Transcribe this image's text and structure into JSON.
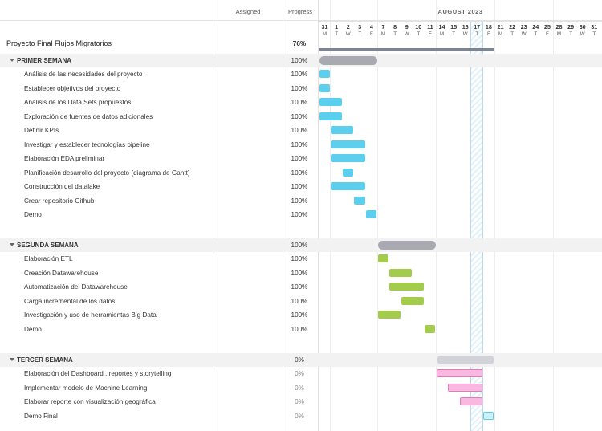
{
  "columns": {
    "assigned": "Assigned",
    "progress": "Progress"
  },
  "timeline": {
    "month": "AUGUST 2023",
    "days": [
      {
        "num": "31",
        "dow": "M"
      },
      {
        "num": "1",
        "dow": "T"
      },
      {
        "num": "2",
        "dow": "W"
      },
      {
        "num": "3",
        "dow": "T"
      },
      {
        "num": "4",
        "dow": "F"
      },
      {
        "num": "7",
        "dow": "M"
      },
      {
        "num": "8",
        "dow": "T"
      },
      {
        "num": "9",
        "dow": "W"
      },
      {
        "num": "10",
        "dow": "T"
      },
      {
        "num": "11",
        "dow": "F"
      },
      {
        "num": "14",
        "dow": "M"
      },
      {
        "num": "15",
        "dow": "T"
      },
      {
        "num": "16",
        "dow": "W"
      },
      {
        "num": "17",
        "dow": "T"
      },
      {
        "num": "18",
        "dow": "F"
      },
      {
        "num": "21",
        "dow": "M"
      },
      {
        "num": "22",
        "dow": "T"
      },
      {
        "num": "23",
        "dow": "W"
      },
      {
        "num": "24",
        "dow": "T"
      },
      {
        "num": "25",
        "dow": "F"
      },
      {
        "num": "28",
        "dow": "M"
      },
      {
        "num": "29",
        "dow": "T"
      },
      {
        "num": "30",
        "dow": "W"
      },
      {
        "num": "31",
        "dow": "T"
      }
    ],
    "today_index": 13,
    "progress_rule_end_index": 15
  },
  "project": {
    "name": "Proyecto Final Flujos Migratorios",
    "progress": "76%"
  },
  "colors": {
    "summary_bar": "#a9a9b1",
    "summary_bar_pending": "#d2d3d8",
    "week1_bar": "#5ccfee",
    "week2_bar": "#a3cc4d",
    "week3_bar": "#f8b8df",
    "week3_border": "#e07cbb",
    "final_bar": "#c8f3fb"
  },
  "groups": [
    {
      "name": "PRIMER SEMANA",
      "progress": "100%",
      "start": 0,
      "end": 5,
      "tasks": [
        {
          "name": "Análisis de las necesidades del proyecto",
          "progress": "100%",
          "start": 0,
          "end": 1
        },
        {
          "name": "Establecer objetivos del proyecto",
          "progress": "100%",
          "start": 0,
          "end": 1
        },
        {
          "name": "Análisis de los Data Sets propuestos",
          "progress": "100%",
          "start": 0,
          "end": 2
        },
        {
          "name": "Exploración de fuentes de datos adicionales",
          "progress": "100%",
          "start": 0,
          "end": 2
        },
        {
          "name": "Definir KPIs",
          "progress": "100%",
          "start": 1,
          "end": 3
        },
        {
          "name": "Investigar y establecer tecnologías pipeline",
          "progress": "100%",
          "start": 1,
          "end": 4
        },
        {
          "name": "Elaboración EDA preliminar",
          "progress": "100%",
          "start": 1,
          "end": 4
        },
        {
          "name": "Planificación desarrollo del proyecto (diagrama de Gantt)",
          "progress": "100%",
          "start": 2,
          "end": 3
        },
        {
          "name": "Construcción del datalake",
          "progress": "100%",
          "start": 1,
          "end": 4
        },
        {
          "name": "Crear repositorio Github",
          "progress": "100%",
          "start": 3,
          "end": 4
        },
        {
          "name": "Demo",
          "progress": "100%",
          "start": 4,
          "end": 5
        }
      ]
    },
    {
      "name": "SEGUNDA SEMANA",
      "progress": "100%",
      "start": 5,
      "end": 10,
      "tasks": [
        {
          "name": "Elaboración ETL",
          "progress": "100%",
          "start": 5,
          "end": 6
        },
        {
          "name": "Creación Datawarehouse",
          "progress": "100%",
          "start": 6,
          "end": 8
        },
        {
          "name": "Automatización del Datawarehouse",
          "progress": "100%",
          "start": 6,
          "end": 9
        },
        {
          "name": "Carga incremental de los datos",
          "progress": "100%",
          "start": 7,
          "end": 9
        },
        {
          "name": "Investigación y uso de herramientas Big Data",
          "progress": "100%",
          "start": 5,
          "end": 7
        },
        {
          "name": "Demo",
          "progress": "100%",
          "start": 9,
          "end": 10
        }
      ]
    },
    {
      "name": "TERCER SEMANA",
      "progress": "0%",
      "start": 10,
      "end": 15,
      "tasks": [
        {
          "name": "Elaboración del Dashboard , reportes y storytelling",
          "progress": "0%",
          "start": 10,
          "end": 14
        },
        {
          "name": "Implementar modelo de Machine Learning",
          "progress": "0%",
          "start": 11,
          "end": 14
        },
        {
          "name": "Elaborar reporte con visualización geográfica",
          "progress": "0%",
          "start": 12,
          "end": 14
        },
        {
          "name": "Demo Final",
          "progress": "0%",
          "start": 14,
          "end": 15
        }
      ]
    }
  ]
}
